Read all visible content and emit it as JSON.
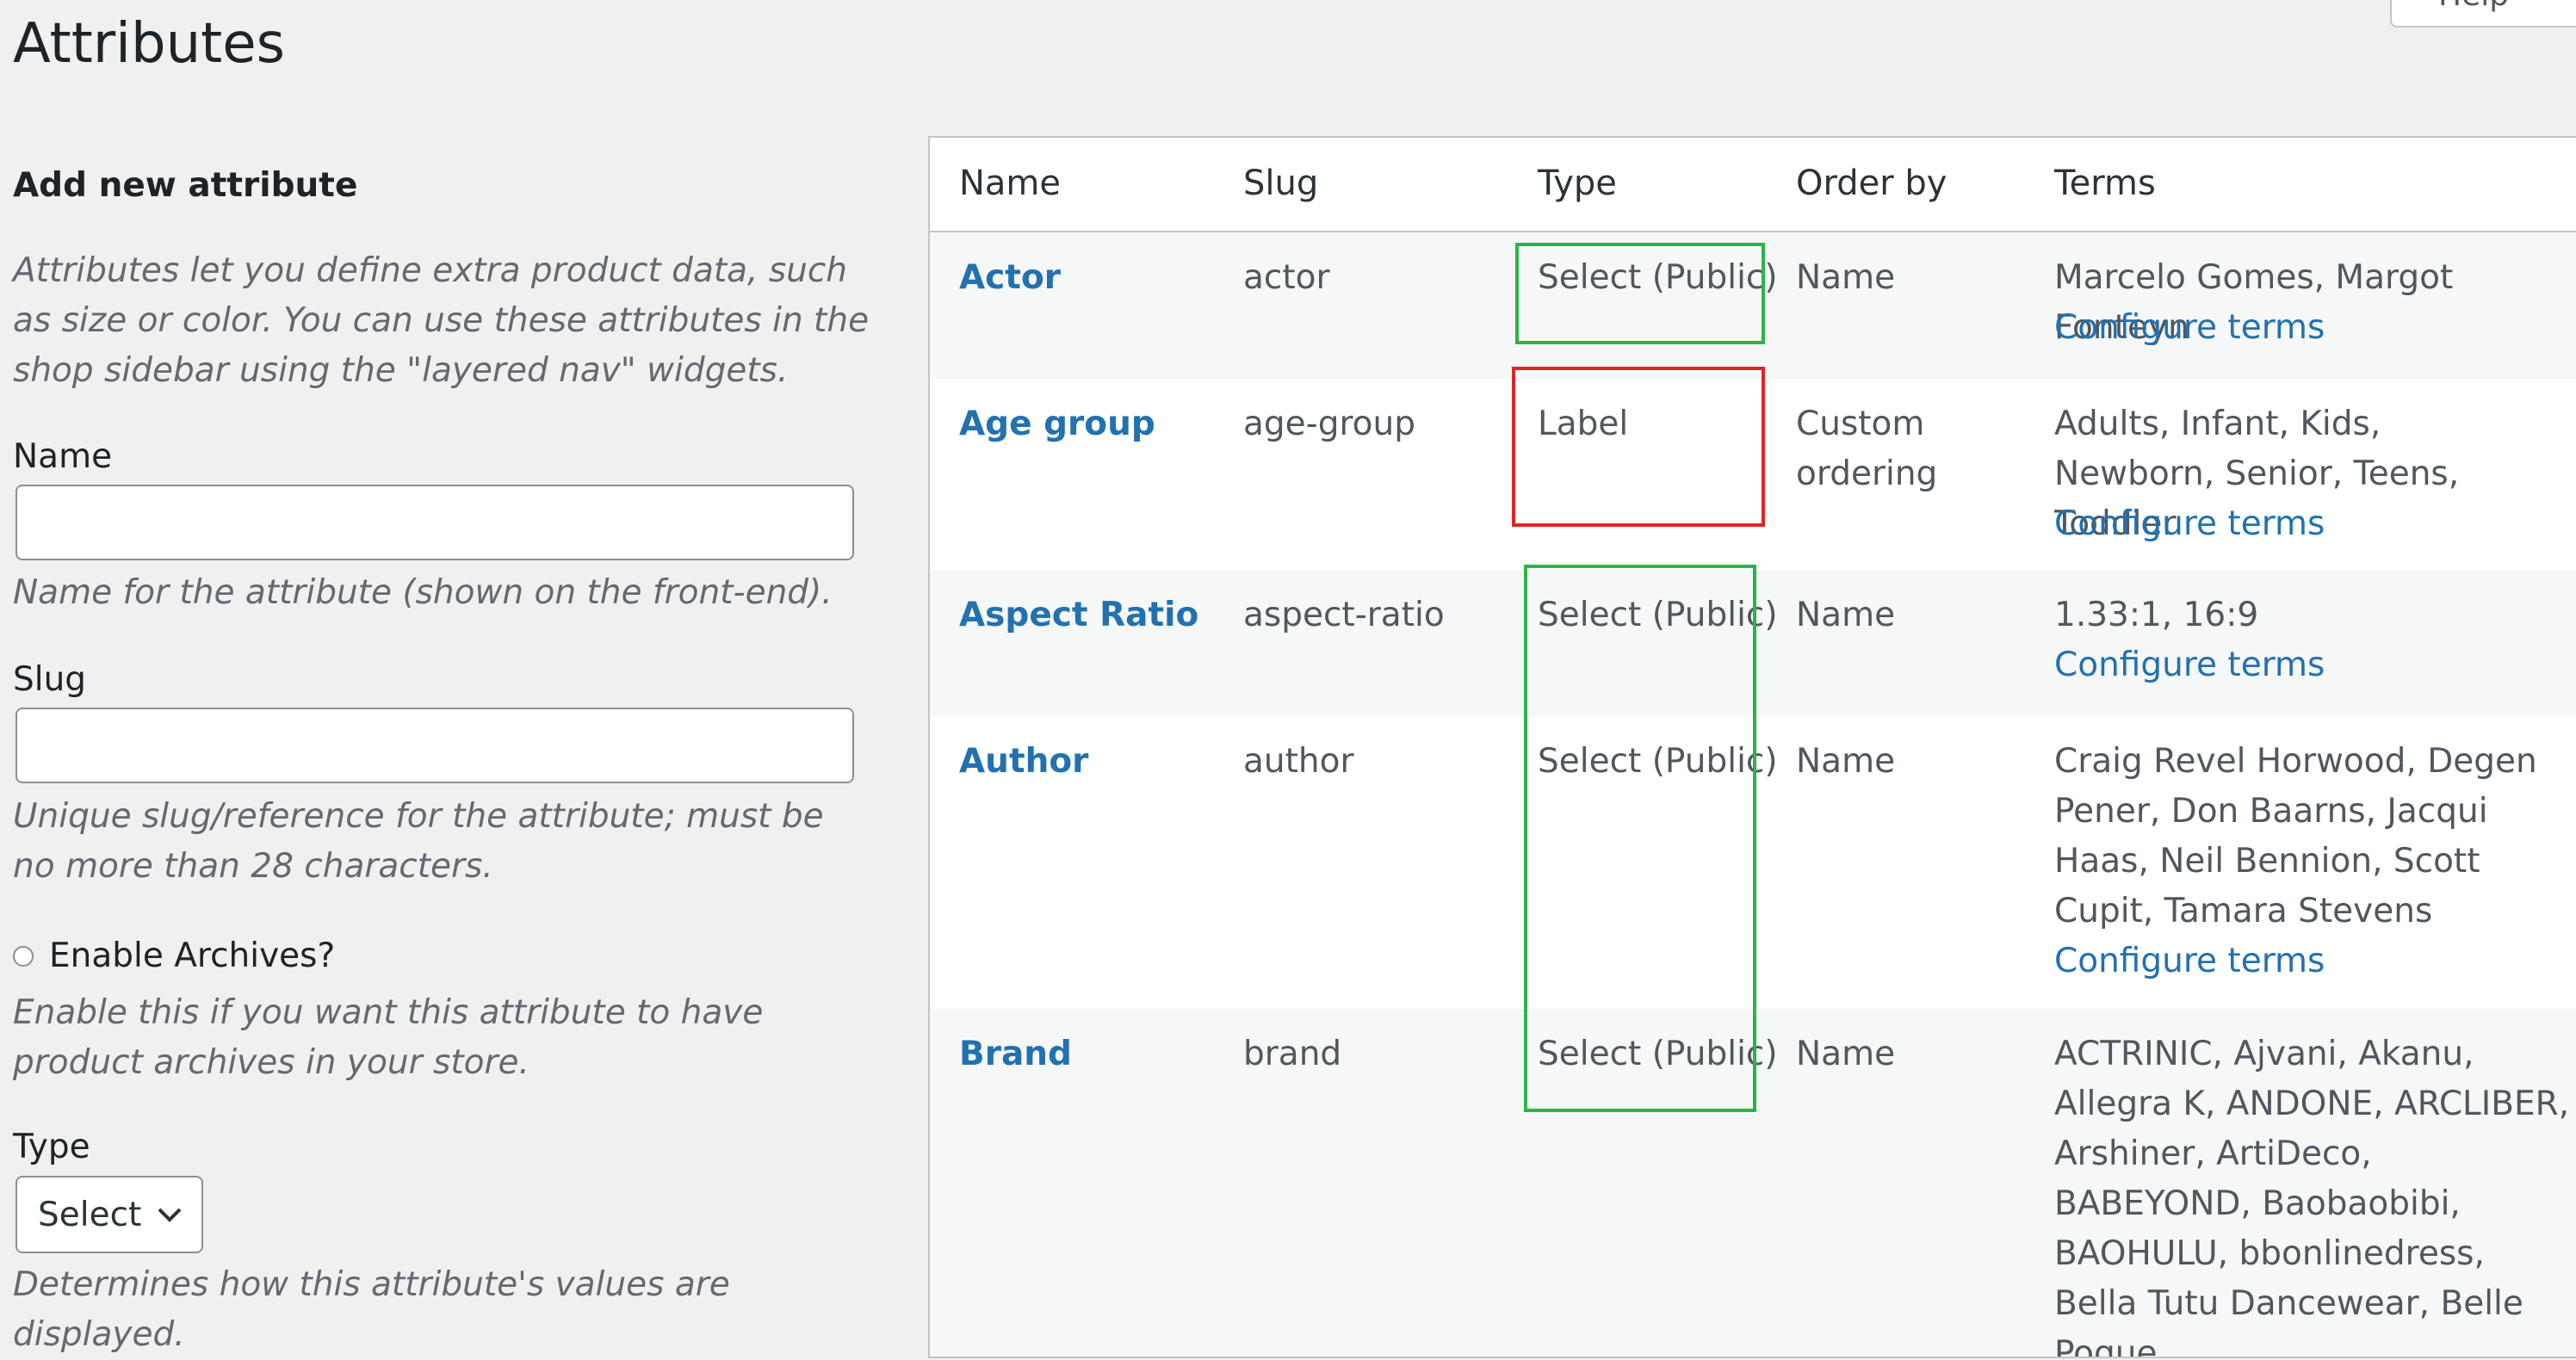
{
  "page_title": "Attributes",
  "help_tab": "Help",
  "form": {
    "section_title": "Add new attribute",
    "intro": "Attributes let you define extra product data, such as size or color. You can use these attributes in the shop sidebar using the \"layered nav\" widgets.",
    "name_label": "Name",
    "name_help": "Name for the attribute (shown on the front-end).",
    "slug_label": "Slug",
    "slug_help": "Unique slug/reference for the attribute; must be no more than 28 characters.",
    "archives_label": "Enable Archives?",
    "archives_help": "Enable this if you want this attribute to have product archives in your store.",
    "type_label": "Type",
    "type_value": "Select",
    "type_help": "Determines how this attribute's values are displayed."
  },
  "table": {
    "headers": {
      "name": "Name",
      "slug": "Slug",
      "type": "Type",
      "order_by": "Order by",
      "terms": "Terms"
    },
    "rows": [
      {
        "name": "Actor",
        "slug": "actor",
        "type": "Select (Public)",
        "order_by": "Name",
        "terms": "Marcelo Gomes, Margot Fonteyn",
        "configure": "Configure terms"
      },
      {
        "name": "Age group",
        "slug": "age-group",
        "type": "Label",
        "order_by": "Custom ordering",
        "terms": "Adults, Infant, Kids, Newborn, Senior, Teens, Toddler",
        "configure": "Configure terms"
      },
      {
        "name": "Aspect Ratio",
        "slug": "aspect-ratio",
        "type": "Select (Public)",
        "order_by": "Name",
        "terms": "1.33:1, 16:9",
        "configure": "Configure terms"
      },
      {
        "name": "Author",
        "slug": "author",
        "type": "Select (Public)",
        "order_by": "Name",
        "terms": "Craig Revel Horwood, Degen Pener, Don Baarns, Jacqui Haas, Neil Bennion, Scott Cupit, Tamara Stevens",
        "configure": "Configure terms"
      },
      {
        "name": "Brand",
        "slug": "brand",
        "type": "Select (Public)",
        "order_by": "Name",
        "terms": "ACTRINIC, Ajvani, Akanu, Allegra K, ANDONE, ARCLIBER, Arshiner, ArtiDeco, BABEYOND, Baobaobibi, BAOHULU, bbonlinedress, Bella Tutu Dancewear, Belle Poque,"
      }
    ]
  },
  "highlight_colors": {
    "green": "#2db34a",
    "red": "#e02424"
  }
}
